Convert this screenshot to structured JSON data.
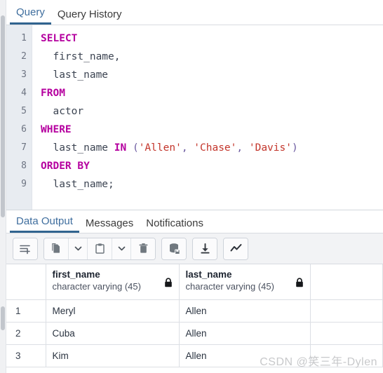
{
  "query_tabs": [
    {
      "label": "Query",
      "active": true
    },
    {
      "label": "Query History",
      "active": false
    }
  ],
  "editor": {
    "line_numbers": [
      "1",
      "2",
      "3",
      "4",
      "5",
      "6",
      "7",
      "8",
      "9"
    ],
    "lines": [
      {
        "n": "1",
        "tokens": [
          {
            "t": "SELECT",
            "c": "kw"
          }
        ]
      },
      {
        "n": "2",
        "tokens": [
          {
            "t": "  first_name,",
            "c": "ident"
          }
        ]
      },
      {
        "n": "3",
        "tokens": [
          {
            "t": "  last_name",
            "c": "ident"
          }
        ]
      },
      {
        "n": "4",
        "tokens": [
          {
            "t": "FROM",
            "c": "kw"
          }
        ]
      },
      {
        "n": "5",
        "tokens": [
          {
            "t": "  actor",
            "c": "ident"
          }
        ]
      },
      {
        "n": "6",
        "tokens": [
          {
            "t": "WHERE",
            "c": "kw"
          }
        ]
      },
      {
        "n": "7",
        "tokens": [
          {
            "t": "  last_name ",
            "c": "ident"
          },
          {
            "t": "IN",
            "c": "kw"
          },
          {
            "t": " (",
            "c": "punc"
          },
          {
            "t": "'Allen'",
            "c": "str"
          },
          {
            "t": ", ",
            "c": "punc"
          },
          {
            "t": "'Chase'",
            "c": "str"
          },
          {
            "t": ", ",
            "c": "punc"
          },
          {
            "t": "'Davis'",
            "c": "str"
          },
          {
            "t": ")",
            "c": "punc"
          }
        ]
      },
      {
        "n": "8",
        "tokens": [
          {
            "t": "ORDER BY",
            "c": "kw"
          }
        ]
      },
      {
        "n": "9",
        "tokens": [
          {
            "t": "  last_name;",
            "c": "ident"
          }
        ]
      }
    ],
    "plain_text": "SELECT\n  first_name,\n  last_name\nFROM\n  actor\nWHERE\n  last_name IN ('Allen', 'Chase', 'Davis')\nORDER BY\n  last_name;"
  },
  "result_tabs": [
    {
      "label": "Data Output",
      "active": true
    },
    {
      "label": "Messages",
      "active": false
    },
    {
      "label": "Notifications",
      "active": false
    }
  ],
  "toolbar": {
    "groups": [
      {
        "buttons": [
          {
            "icon": "add-row-icon",
            "label": "Add row"
          }
        ]
      },
      {
        "buttons": [
          {
            "icon": "copy-icon",
            "label": "Copy"
          },
          {
            "icon": "chevron-down-icon",
            "label": "Copy options"
          },
          {
            "icon": "paste-icon",
            "label": "Paste"
          },
          {
            "icon": "chevron-down-icon",
            "label": "Paste options"
          },
          {
            "icon": "trash-icon",
            "label": "Delete row"
          }
        ]
      },
      {
        "buttons": [
          {
            "icon": "save-data-changes-icon",
            "label": "Save data changes"
          }
        ]
      },
      {
        "buttons": [
          {
            "icon": "download-icon",
            "label": "Download as CSV"
          }
        ]
      },
      {
        "buttons": [
          {
            "icon": "graph-visualiser-icon",
            "label": "Graph Visualiser"
          }
        ]
      }
    ]
  },
  "grid": {
    "columns": [
      {
        "name": "",
        "type": "",
        "locked": false
      },
      {
        "name": "first_name",
        "type": "character varying (45)",
        "locked": true
      },
      {
        "name": "last_name",
        "type": "character varying (45)",
        "locked": true
      }
    ],
    "rows": [
      {
        "index": "1",
        "first_name": "Meryl",
        "last_name": "Allen"
      },
      {
        "index": "2",
        "first_name": "Cuba",
        "last_name": "Allen"
      },
      {
        "index": "3",
        "first_name": "Kim",
        "last_name": "Allen"
      }
    ]
  },
  "watermark": {
    "text": "CSDN @笑三年-Dylen"
  },
  "colors": {
    "accent": "#31648f",
    "tab_active_text": "#3f6e9e",
    "keyword": "#b5009f",
    "string": "#c3342a",
    "identifier": "#3c4452",
    "gutter_bg": "#e8ecf1",
    "toolbar_bg": "#f2f3f5"
  }
}
